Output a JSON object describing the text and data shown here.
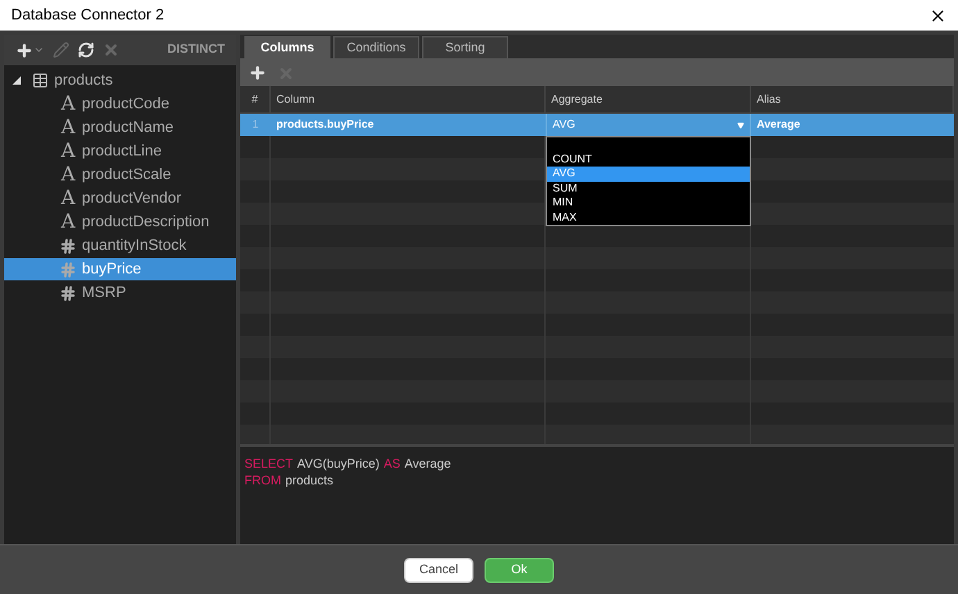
{
  "window": {
    "title": "Database Connector 2"
  },
  "left_toolbar": {
    "tools": [
      {
        "kind": "add",
        "disabled": false
      },
      {
        "kind": "edit",
        "disabled": true
      },
      {
        "kind": "refresh",
        "disabled": false
      },
      {
        "kind": "delete",
        "disabled": true
      }
    ],
    "distinct": "DISTINCT"
  },
  "tree": [
    {
      "label": "products",
      "kind": "table",
      "expanded": true,
      "selected": false,
      "children": [
        {
          "label": "productCode",
          "kind": "text",
          "type_glyph": "A",
          "selected": false
        },
        {
          "label": "productName",
          "kind": "text",
          "type_glyph": "A",
          "selected": false
        },
        {
          "label": "productLine",
          "kind": "text",
          "type_glyph": "A",
          "selected": false
        },
        {
          "label": "productScale",
          "kind": "text",
          "type_glyph": "A",
          "selected": false
        },
        {
          "label": "productVendor",
          "kind": "text",
          "type_glyph": "A",
          "selected": false
        },
        {
          "label": "productDescription",
          "kind": "text",
          "type_glyph": "A",
          "selected": false
        },
        {
          "label": "quantityInStock",
          "kind": "number",
          "selected": false
        },
        {
          "label": "buyPrice",
          "kind": "number",
          "selected": true
        },
        {
          "label": "MSRP",
          "kind": "number",
          "selected": false
        }
      ]
    }
  ],
  "tabs": [
    {
      "label": "Columns",
      "selected": true
    },
    {
      "label": "Conditions",
      "selected": false
    },
    {
      "label": "Sorting",
      "selected": false
    }
  ],
  "grid_toolbar": [
    {
      "kind": "add",
      "disabled": false
    },
    {
      "kind": "delete",
      "disabled": true
    }
  ],
  "table": {
    "columns": [
      "#",
      "Column",
      "Aggregate",
      "Alias"
    ],
    "rows": [
      {
        "num": "1",
        "column": "products.buyPrice",
        "aggregate": "AVG",
        "alias": "Average",
        "selected": true
      }
    ]
  },
  "dropdown": {
    "options": [
      {
        "label": "COUNT",
        "selected": false
      },
      {
        "label": "AVG",
        "selected": true
      },
      {
        "label": "SUM",
        "selected": false
      },
      {
        "label": "MIN",
        "selected": false
      },
      {
        "label": "MAX",
        "selected": false
      }
    ]
  },
  "sql": [
    [
      {
        "kind": "keyword",
        "text": "SELECT"
      },
      {
        "kind": "text",
        "text": "AVG(buyPrice)"
      },
      {
        "kind": "keyword",
        "text": "AS"
      },
      {
        "kind": "text",
        "text": "Average"
      }
    ],
    [
      {
        "kind": "keyword",
        "text": "FROM"
      },
      {
        "kind": "text",
        "text": "products"
      }
    ]
  ],
  "buttons": [
    {
      "label": "Cancel",
      "kind": "secondary"
    },
    {
      "label": "Ok",
      "kind": "primary"
    }
  ]
}
